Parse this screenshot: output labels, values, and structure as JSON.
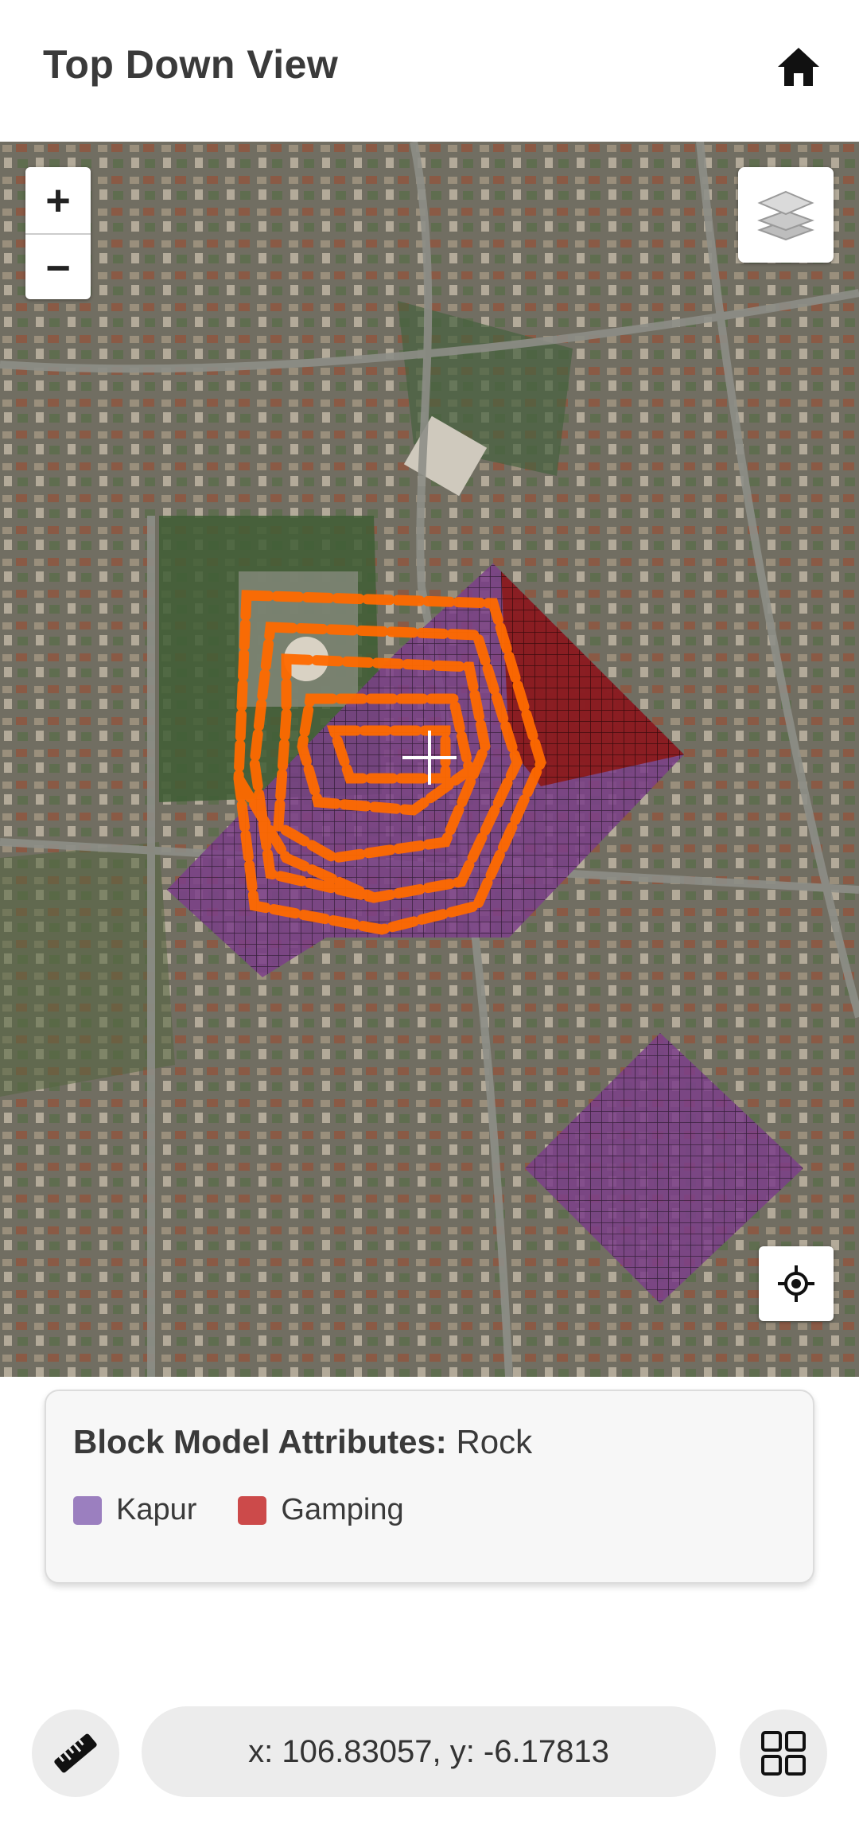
{
  "header": {
    "title": "Top Down View",
    "home_icon": "home-icon"
  },
  "map": {
    "zoom_in_label": "+",
    "zoom_out_label": "−",
    "layers_icon": "layers-icon",
    "locate_icon": "locate-icon",
    "crosshair_icon": "crosshair-icon",
    "colors": {
      "kapur": "#7b3f8a",
      "gamping": "#8b1a1a",
      "track": "#ff6a00"
    }
  },
  "legend": {
    "title_bold": "Block Model Attributes:",
    "title_value": "Rock",
    "items": [
      {
        "label": "Kapur",
        "color": "#9b7fbf"
      },
      {
        "label": "Gamping",
        "color": "#cc4a4a"
      }
    ]
  },
  "bottom": {
    "coordinates": "x: 106.83057, y: -6.17813",
    "ruler_icon": "ruler-icon",
    "grid_icon": "grid-icon"
  }
}
